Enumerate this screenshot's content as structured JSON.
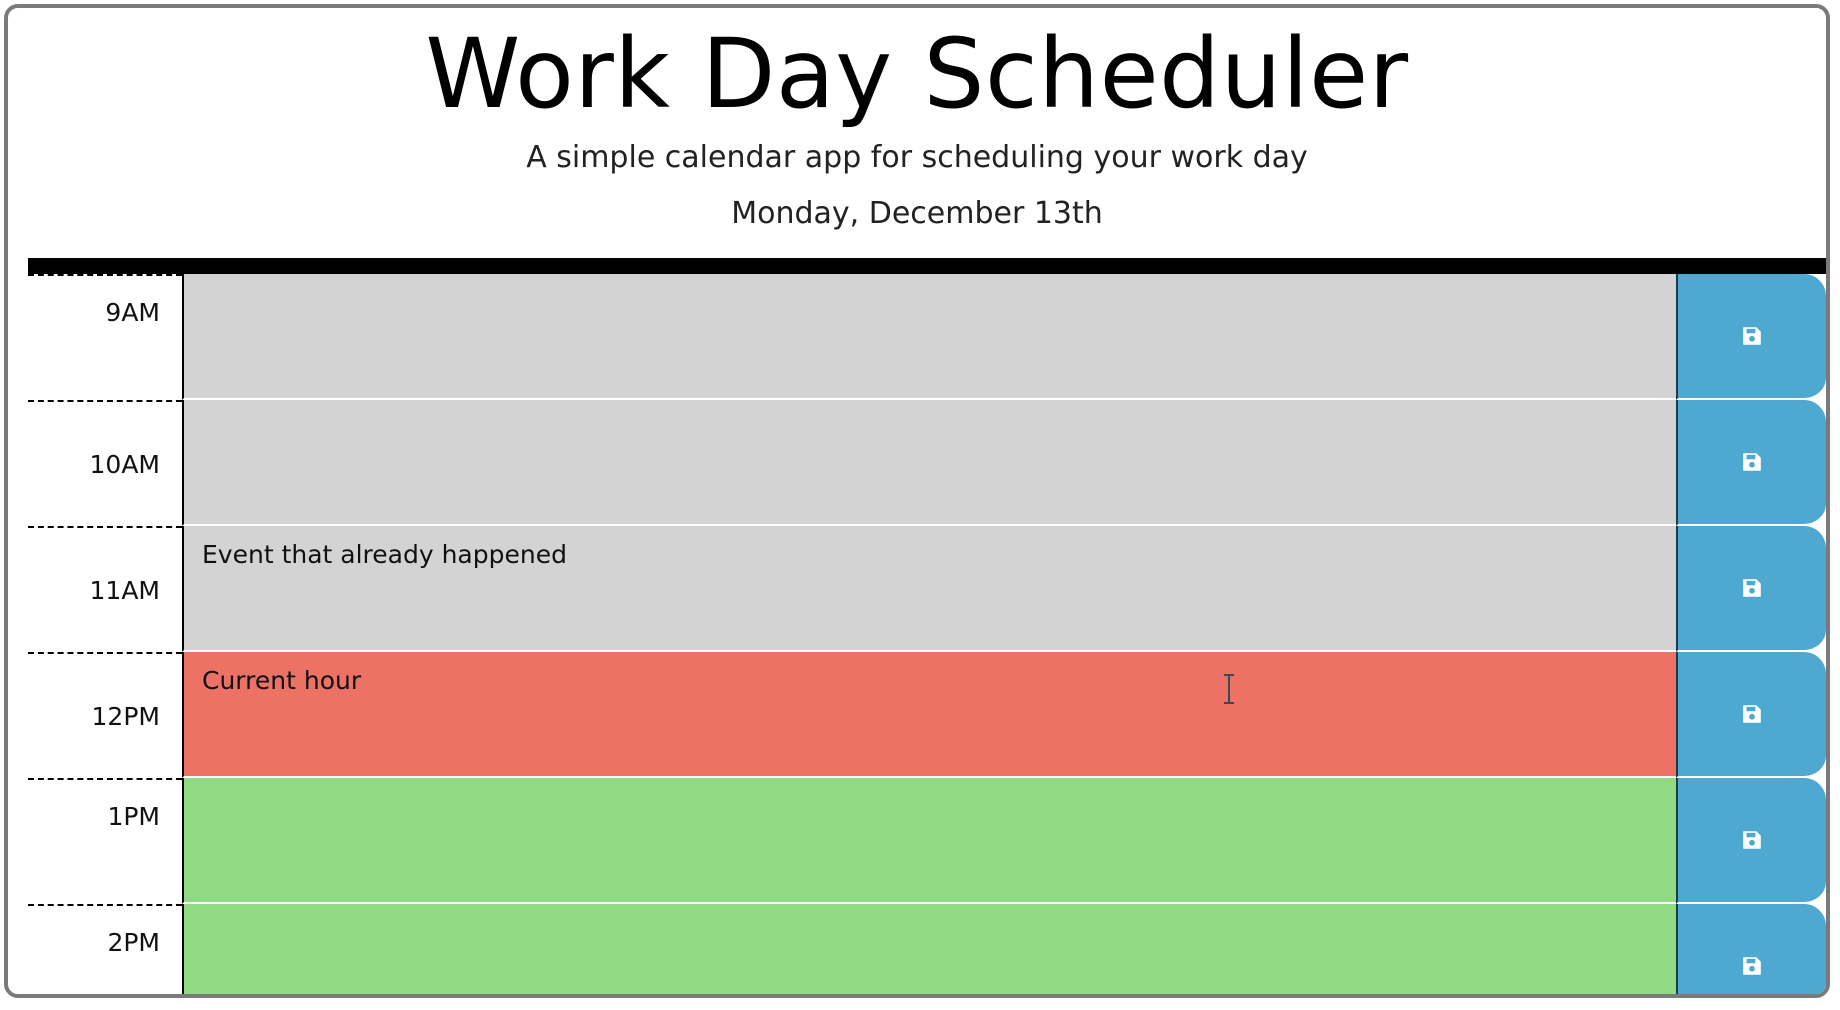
{
  "header": {
    "title": "Work Day Scheduler",
    "subtitle": "A simple calendar app for scheduling your work day",
    "current_day": "Monday, December 13th"
  },
  "hours": [
    {
      "label": "9AM",
      "text": "",
      "state": "past"
    },
    {
      "label": "10AM",
      "text": "",
      "state": "past"
    },
    {
      "label": "11AM",
      "text": "Event that already happened",
      "state": "past"
    },
    {
      "label": "12PM",
      "text": "Current hour",
      "state": "present"
    },
    {
      "label": "1PM",
      "text": "",
      "state": "future"
    },
    {
      "label": "2PM",
      "text": "",
      "state": "future"
    }
  ],
  "save_icon": "floppy-disk-icon",
  "colors": {
    "past": "#d3d3d3",
    "present": "#ec7266",
    "future": "#90da84",
    "save_button": "#4ea8d0"
  }
}
